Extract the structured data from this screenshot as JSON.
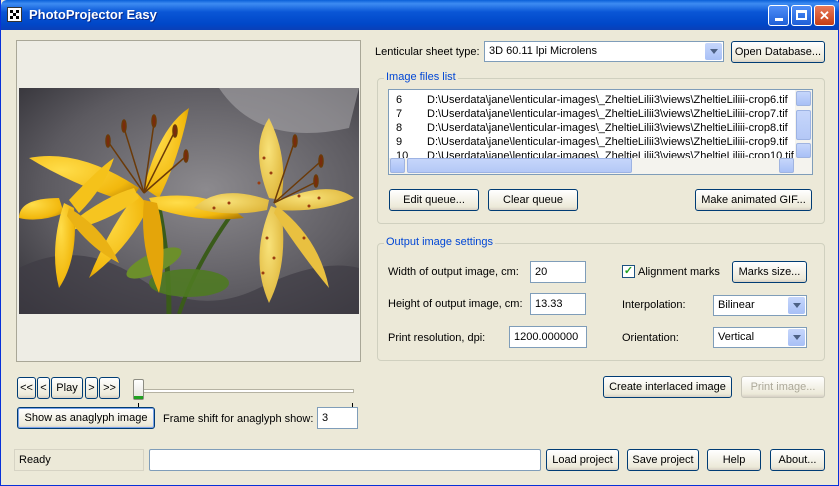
{
  "window": {
    "title": "PhotoProjector Easy",
    "controls": [
      "minimize",
      "maximize",
      "close"
    ]
  },
  "lenticular": {
    "label": "Lenticular sheet type:",
    "value": "3D 60.11 lpi Microlens"
  },
  "open_db_label": "Open Database...",
  "image_files": {
    "title": "Image files list",
    "rows": [
      {
        "num": "6",
        "path": "D:\\Userdata\\jane\\lenticular-images\\_ZheltieLilii3\\views\\ZheltieLiliii-crop6.tif"
      },
      {
        "num": "7",
        "path": "D:\\Userdata\\jane\\lenticular-images\\_ZheltieLilii3\\views\\ZheltieLiliii-crop7.tif"
      },
      {
        "num": "8",
        "path": "D:\\Userdata\\jane\\lenticular-images\\_ZheltieLilii3\\views\\ZheltieLiliii-crop8.tif"
      },
      {
        "num": "9",
        "path": "D:\\Userdata\\jane\\lenticular-images\\_ZheltieLilii3\\views\\ZheltieLiliii-crop9.tif"
      },
      {
        "num": "10",
        "path": "D:\\Userdata\\jane\\lenticular-images\\_ZheltieLilii3\\views\\ZheltieLiliii-crop10.tif"
      }
    ],
    "edit_queue": "Edit queue...",
    "clear_queue": "Clear queue",
    "make_gif": "Make animated GIF..."
  },
  "output": {
    "title": "Output image settings",
    "width_label": "Width of output image, cm:",
    "width_value": "20",
    "height_label": "Height of output image, cm:",
    "height_value": "13.33",
    "res_label": "Print resolution, dpi:",
    "res_value": "1200.000000",
    "alignment_label": "Alignment marks",
    "alignment_checked": true,
    "marks_size": "Marks size...",
    "interp_label": "Interpolation:",
    "interp_value": "Bilinear",
    "orient_label": "Orientation:",
    "orient_value": "Vertical"
  },
  "playback": {
    "first": "<<",
    "prev": "<",
    "play": "Play",
    "next": ">",
    "last": ">>"
  },
  "anaglyph": {
    "button": "Show as anaglyph image",
    "shift_label": "Frame shift for anaglyph show:",
    "shift_value": "3"
  },
  "create_interlaced": "Create interlaced image",
  "print_image": "Print image...",
  "status": "Ready",
  "footer": {
    "load": "Load project",
    "save": "Save project",
    "help": "Help",
    "about": "About..."
  },
  "colors": {
    "titlebar": "#0a56d6",
    "window_bg": "#ece9d8",
    "group_title": "#0046d5"
  }
}
